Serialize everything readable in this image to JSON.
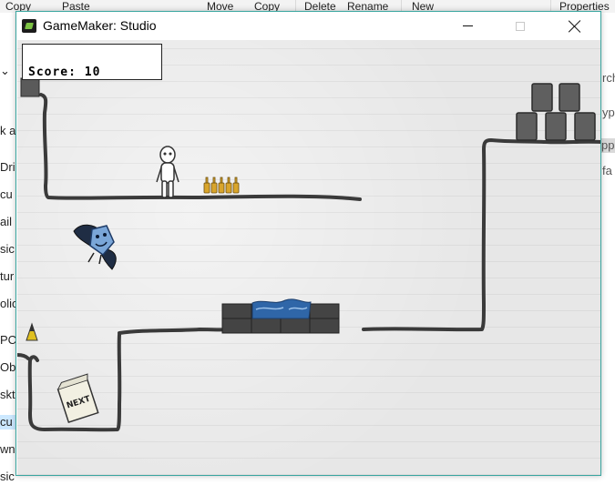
{
  "background_window": {
    "ribbon_labels": [
      "Copy",
      "Paste",
      "Move",
      "Copy",
      "Delete",
      "Rename",
      "New",
      "Properties"
    ],
    "left_items": [
      "k a",
      "Dri",
      "cu",
      "ail",
      "sic",
      "tur",
      "olic",
      "PC",
      "Ob",
      "skt",
      "cu",
      "wn",
      "sic"
    ],
    "right_items": [
      "rch",
      "yp",
      "pp",
      "fa"
    ]
  },
  "window": {
    "title": "GameMaker: Studio",
    "icon": "gamemaker-icon",
    "controls": [
      "minimize-icon",
      "maximize-icon",
      "close-icon"
    ]
  },
  "game": {
    "score_label": "Score:",
    "score_value": "10",
    "score_text": "Score: 10",
    "next_sign": "NEXT",
    "colors": {
      "wall_line": "#3a3a3a",
      "background": "#e7e7e7",
      "water": "#2f66a8",
      "stone": "#555555",
      "bottles": "#d9a52b"
    }
  }
}
